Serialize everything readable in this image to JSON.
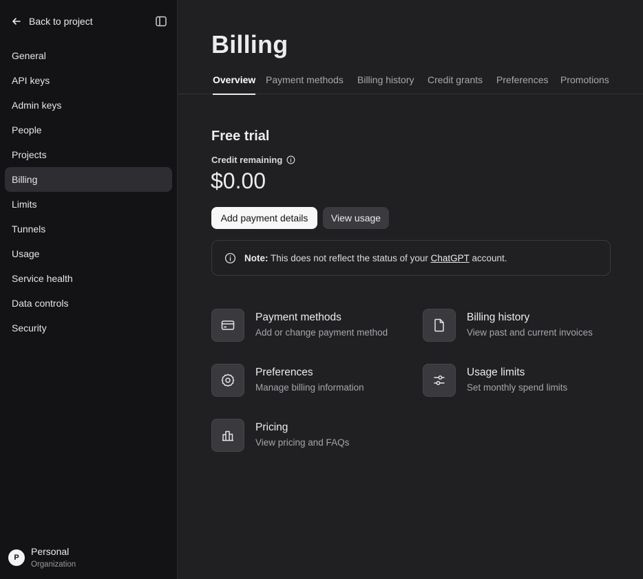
{
  "sidebar": {
    "back_label": "Back to project",
    "items": [
      {
        "label": "General"
      },
      {
        "label": "API keys"
      },
      {
        "label": "Admin keys"
      },
      {
        "label": "People"
      },
      {
        "label": "Projects"
      },
      {
        "label": "Billing",
        "active": true
      },
      {
        "label": "Limits"
      },
      {
        "label": "Tunnels"
      },
      {
        "label": "Usage"
      },
      {
        "label": "Service health"
      },
      {
        "label": "Data controls"
      },
      {
        "label": "Security"
      }
    ],
    "org": {
      "initial": "P",
      "name": "Personal",
      "sub": "Organization"
    }
  },
  "main": {
    "title": "Billing",
    "tabs": [
      {
        "label": "Overview",
        "active": true
      },
      {
        "label": "Payment methods"
      },
      {
        "label": "Billing history"
      },
      {
        "label": "Credit grants"
      },
      {
        "label": "Preferences"
      },
      {
        "label": "Promotions"
      }
    ],
    "section_title": "Free trial",
    "credit_label": "Credit remaining",
    "credit_amount": "$0.00",
    "buttons": {
      "add_payment": "Add payment details",
      "view_usage": "View usage"
    },
    "note": {
      "bold": "Note:",
      "text_before": "This does not reflect the status of your",
      "link": "ChatGPT",
      "text_after": "account."
    },
    "cards": [
      {
        "title": "Payment methods",
        "sub": "Add or change payment method",
        "icon": "credit-card-icon"
      },
      {
        "title": "Billing history",
        "sub": "View past and current invoices",
        "icon": "document-icon"
      },
      {
        "title": "Preferences",
        "sub": "Manage billing information",
        "icon": "gear-icon"
      },
      {
        "title": "Usage limits",
        "sub": "Set monthly spend limits",
        "icon": "sliders-icon"
      },
      {
        "title": "Pricing",
        "sub": "View pricing and FAQs",
        "icon": "bar-chart-icon"
      }
    ]
  },
  "colors": {
    "sidebar_bg": "#131214",
    "main_bg": "#201f22",
    "active_item_bg": "#2e2d31",
    "primary_button_bg": "#f7f7f7",
    "secondary_button_bg": "#3b3a3e"
  }
}
